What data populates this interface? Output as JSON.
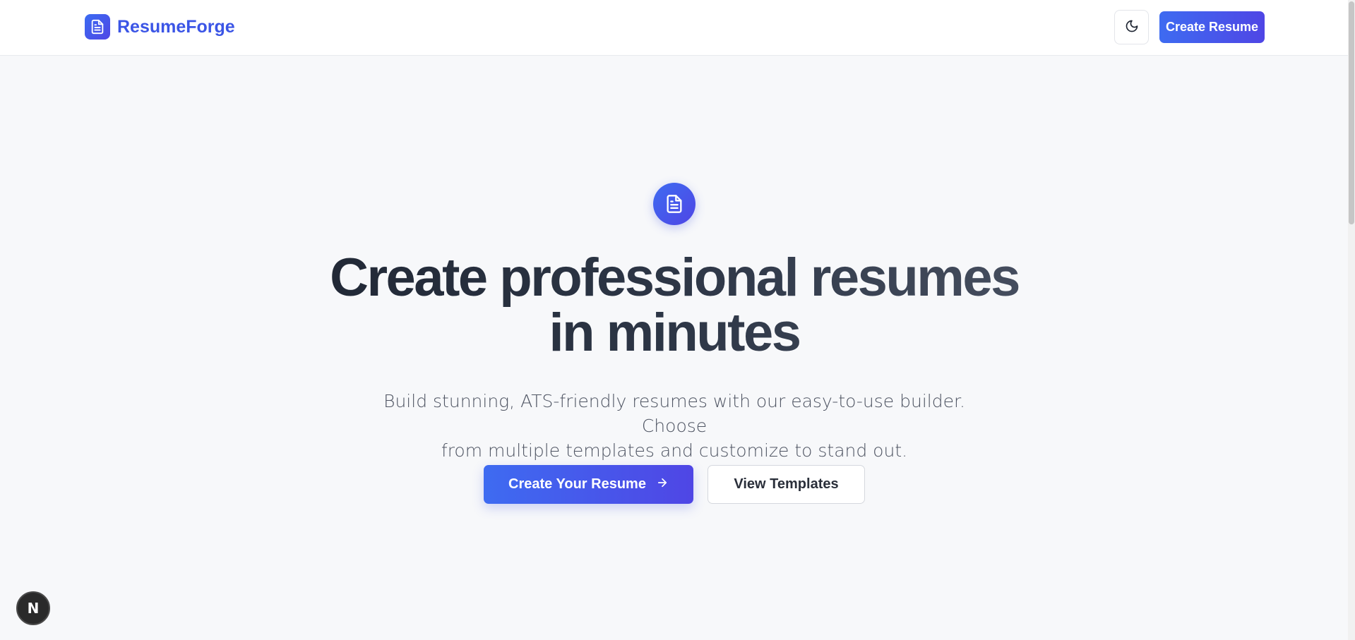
{
  "header": {
    "brand_name": "ResumeForge",
    "brand_icon": "file-text-icon",
    "theme_toggle_icon": "moon-icon",
    "cta_label": "Create Resume"
  },
  "hero": {
    "icon": "file-text-icon",
    "title_line1": "Create professional resumes",
    "title_line2": "in minutes",
    "subtitle_line1": "Build stunning, ATS-friendly resumes with our easy-to-use builder. Choose",
    "subtitle_line2": "from multiple templates and customize to stand out.",
    "primary_button": "Create Your Resume",
    "primary_button_icon": "arrow-right-icon",
    "secondary_button": "View Templates"
  },
  "dev_badge": {
    "label": "N"
  },
  "colors": {
    "accent": "#4f46e5",
    "accent_start": "#3e6bf1",
    "brand_text": "#3b55e6",
    "background": "#f7f8fa",
    "heading": "#1f2633",
    "body_text": "#4f5563"
  }
}
